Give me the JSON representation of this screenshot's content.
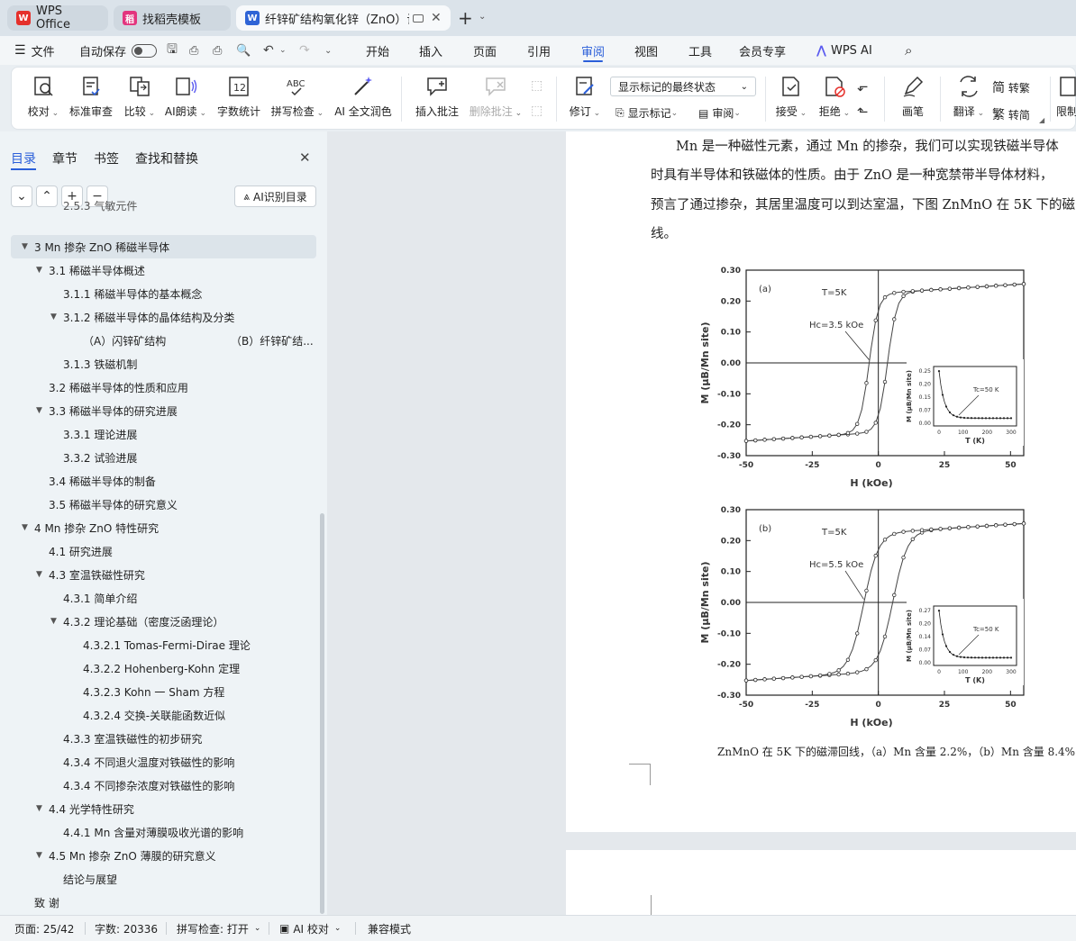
{
  "tabs": [
    {
      "label": "WPS Office",
      "icon": "wps-logo-icon"
    },
    {
      "label": "找稻壳模板",
      "icon": "docer-icon"
    },
    {
      "label": "纤锌矿结构氧化锌（ZnO）设",
      "icon": "word-doc-icon",
      "active": true
    }
  ],
  "menu": {
    "file": "文件",
    "autosave": "自动保存",
    "items": [
      "开始",
      "插入",
      "页面",
      "引用",
      "审阅",
      "视图",
      "工具",
      "会员专享"
    ],
    "selected": "审阅",
    "wps_ai": "WPS AI"
  },
  "ribbon": {
    "proofread": "校对",
    "standard_review": "标准审查",
    "compare": "比较",
    "ai_read": "AI朗读",
    "word_count": "字数统计",
    "spell_check": "拼写检查",
    "ai_color": "AI 全文润色",
    "insert_comment": "插入批注",
    "delete_comment": "删除批注",
    "revise": "修订",
    "markup_select": "显示标记的最终状态",
    "show_markup": "显示标记",
    "review_pane": "审阅",
    "accept": "接受",
    "reject": "拒绝",
    "pen": "画笔",
    "translate": "翻译",
    "to_traditional": "转繁",
    "to_simplified": "转简",
    "restrict": "限制",
    "to_traditional_glyph": "简",
    "to_simplified_glyph": "繁",
    "word_count_glyph": "12",
    "spell_glyph": "ABC"
  },
  "nav": {
    "tabs": [
      "目录",
      "章节",
      "书签",
      "查找和替换"
    ],
    "selected_tab": "目录",
    "ai_toc_button": "AI识别目录",
    "toc": [
      {
        "label": "2.5.3 气敏元件",
        "level": 2
      },
      {
        "label": "3 Mn 掺杂 ZnO 稀磁半导体",
        "level": 0,
        "expanded": true,
        "selected": true
      },
      {
        "label": "3.1  稀磁半导体概述",
        "level": 1,
        "expanded": true
      },
      {
        "label": "3.1.1 稀磁半导体的基本概念",
        "level": 2
      },
      {
        "label": "3.1.2 稀磁半导体的晶体结构及分类",
        "level": 2,
        "expanded": true
      },
      {
        "label": "（A）闪锌矿结构",
        "level": 3,
        "extra": "（B）纤锌矿结..."
      },
      {
        "label": "3.1.3 铁磁机制",
        "level": 2
      },
      {
        "label": "3.2 稀磁半导体的性质和应用",
        "level": 1
      },
      {
        "label": "3.3 稀磁半导体的研究进展",
        "level": 1,
        "expanded": true
      },
      {
        "label": "3.3.1 理论进展",
        "level": 2
      },
      {
        "label": "3.3.2 试验进展",
        "level": 2
      },
      {
        "label": "3.4  稀磁半导体的制备",
        "level": 1
      },
      {
        "label": "3.5 稀磁半导体的研究意义",
        "level": 1
      },
      {
        "label": "4 Mn 掺杂 ZnO 特性研究",
        "level": 0,
        "expanded": true
      },
      {
        "label": "4.1 研究进展",
        "level": 1
      },
      {
        "label": "4.3  室温铁磁性研究",
        "level": 1,
        "expanded": true
      },
      {
        "label": "4.3.1  简单介绍",
        "level": 2
      },
      {
        "label": "4.3.2  理论基础（密度泛函理论）",
        "level": 2,
        "expanded": true
      },
      {
        "label": "4.3.2.1 Tomas-Fermi-Dirae 理论",
        "level": 3
      },
      {
        "label": "4.3.2.2 Hohenberg-Kohn 定理",
        "level": 3
      },
      {
        "label": "4.3.2.3 Kohn 一 Sham 方程",
        "level": 3
      },
      {
        "label": "4.3.2.4 交换-关联能函数近似",
        "level": 3
      },
      {
        "label": "4.3.3  室温铁磁性的初步研究",
        "level": 2
      },
      {
        "label": "4.3.4  不同退火温度对铁磁性的影响",
        "level": 2
      },
      {
        "label": "4.3.4  不同掺杂浓度对铁磁性的影响",
        "level": 2
      },
      {
        "label": "4.4  光学特性研究",
        "level": 1,
        "expanded": true
      },
      {
        "label": "4.4.1 Mn 含量对薄膜吸收光谱的影响",
        "level": 2
      },
      {
        "label": "4.5 Mn 掺杂 ZnO 薄膜的研究意义",
        "level": 1,
        "expanded": true
      },
      {
        "label": "结论与展望",
        "level": 2
      },
      {
        "label": "致  谢",
        "level": 0
      }
    ]
  },
  "document": {
    "lines": [
      "Mn 是一种磁性元素，通过 Mn 的掺杂，我们可以实现铁磁半导体",
      "时具有半导体和铁磁体的性质。由于 ZnO 是一种宽禁带半导体材料，",
      "预言了通过掺杂，其居里温度可以到达室温，下图 ZnMnO 在 5K 下的磁",
      "线。"
    ],
    "caption": "ZnMnO 在 5K 下的磁滞回线，（a）Mn 含量 2.2%，（b）Mn 含量 8.4%"
  },
  "figures": [
    {
      "panel": "(a)",
      "temp": "T=5K",
      "hc": "Hc=3.5 kOe",
      "hc_value": 3.5,
      "ylabel": "M (μB/Mn site)",
      "xlabel": "H (kOe)",
      "yticks": [
        "0.30",
        "0.20",
        "0.10",
        "0.00",
        "-0.10",
        "-0.20",
        "-0.30"
      ],
      "xticks": [
        "-50",
        "-25",
        "0",
        "25",
        "50"
      ],
      "inset": {
        "yticks": [
          "0.25",
          "0.20",
          "0.15",
          "0.07",
          "0.00"
        ],
        "xticks": [
          "0",
          "100",
          "200",
          "300"
        ],
        "xlabel": "T (K)",
        "ylabel": "M (μB/Mn site)",
        "tc": "Tc=50 K"
      }
    },
    {
      "panel": "(b)",
      "temp": "T=5K",
      "hc": "Hc=5.5 kOe",
      "hc_value": 5.5,
      "ylabel": "M (μB/Mn site)",
      "xlabel": "H (kOe)",
      "yticks": [
        "0.30",
        "0.20",
        "0.10",
        "0.00",
        "-0.10",
        "-0.20",
        "-0.30"
      ],
      "xticks": [
        "-50",
        "-25",
        "0",
        "25",
        "50"
      ],
      "inset": {
        "yticks": [
          "0.27",
          "0.20",
          "0.14",
          "0.07",
          "0.00"
        ],
        "xticks": [
          "0",
          "100",
          "200",
          "300"
        ],
        "xlabel": "T (K)",
        "ylabel": "M (μB/Mn site)",
        "tc": "Tc=50 K"
      }
    }
  ],
  "status": {
    "page": "页面: 25/42",
    "words": "字数: 20336",
    "spell": "拼写检查: 打开",
    "ai_proof": "AI 校对",
    "compat": "兼容模式"
  },
  "colors": {
    "accent": "#2b5fd9",
    "wps_red": "#e5302b",
    "word_blue": "#2f64d6"
  }
}
